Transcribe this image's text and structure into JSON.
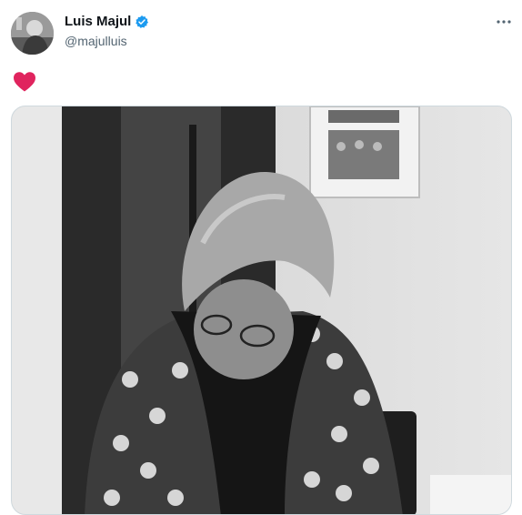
{
  "author": {
    "display_name": "Luis Majul",
    "handle": "@majulluis",
    "verified": true
  },
  "tweet": {
    "text_icon": "heart-icon",
    "heart_color": "#e0245e"
  },
  "colors": {
    "verified_blue": "#1d9bf0",
    "name": "#0f1419",
    "handle": "#536471"
  }
}
